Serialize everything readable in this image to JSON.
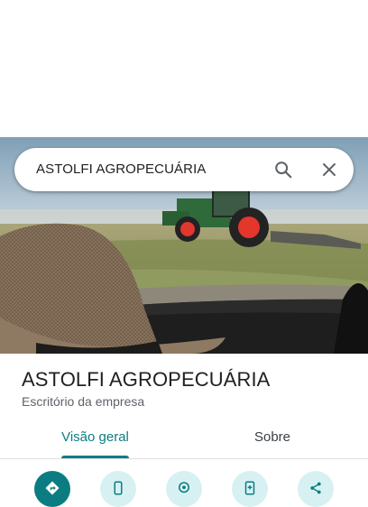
{
  "search": {
    "query": "ASTOLFI AGROPECUÁRIA",
    "search_icon": "search-icon",
    "clear_icon": "close-icon"
  },
  "place": {
    "title": "ASTOLFI AGROPECUÁRIA",
    "category": "Escritório da empresa"
  },
  "tabs": [
    {
      "label": "Visão geral",
      "active": true
    },
    {
      "label": "Sobre",
      "active": false
    }
  ],
  "actions": [
    {
      "icon": "directions-icon",
      "style": "primary"
    },
    {
      "icon": "phone-icon",
      "style": "secondary"
    },
    {
      "icon": "location-pin-icon",
      "style": "secondary"
    },
    {
      "icon": "save-to-phone-icon",
      "style": "secondary"
    },
    {
      "icon": "share-icon",
      "style": "secondary"
    }
  ],
  "colors": {
    "accent": "#0b7d82",
    "accent_light": "#d7f1f2",
    "text_primary": "#202124",
    "text_secondary": "#5f6368"
  }
}
